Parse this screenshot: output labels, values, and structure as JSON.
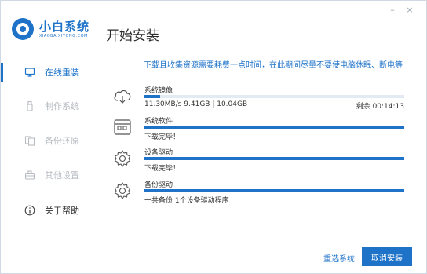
{
  "app": {
    "logo_title": "小白系统",
    "logo_subtitle": "XIAOBAIXITONG.COM",
    "page_title": "开始安装",
    "window_controls": {
      "minimize": "–",
      "close": "×"
    }
  },
  "sidebar": {
    "items": [
      {
        "label": "在线重装",
        "icon": "monitor-icon",
        "state": "active"
      },
      {
        "label": "制作系统",
        "icon": "usb-icon",
        "state": "disabled"
      },
      {
        "label": "备份还原",
        "icon": "backup-icon",
        "state": "disabled"
      },
      {
        "label": "其他设置",
        "icon": "toolbox-icon",
        "state": "disabled"
      },
      {
        "label": "关于帮助",
        "icon": "info-icon",
        "state": "normal"
      }
    ]
  },
  "notice": "下载且收集资源需要耗费一点时间，在此期间尽量不要使电脑休眠、断电等",
  "tasks": [
    {
      "name": "系统镜像",
      "icon": "cloud-download-icon",
      "progress": 0.06,
      "status": "11.30MB/s 9.41GB | 10.04GB",
      "remaining": "剩余 00:14:13"
    },
    {
      "name": "系统软件",
      "icon": "apps-icon",
      "progress": 1.0,
      "status": "下载完毕！",
      "remaining": ""
    },
    {
      "name": "设备驱动",
      "icon": "gear-icon",
      "progress": 1.0,
      "status": "下载完毕！",
      "remaining": ""
    },
    {
      "name": "备份驱动",
      "icon": "gear-icon",
      "progress": 1.0,
      "status": "一共备份 1个设备驱动程序",
      "remaining": ""
    }
  ],
  "footer": {
    "reselect_label": "重选系统",
    "cancel_label": "取消安装"
  },
  "colors": {
    "accent": "#1e73c9",
    "track": "#e3eaf3",
    "disabled_text": "#b7bcc2"
  }
}
